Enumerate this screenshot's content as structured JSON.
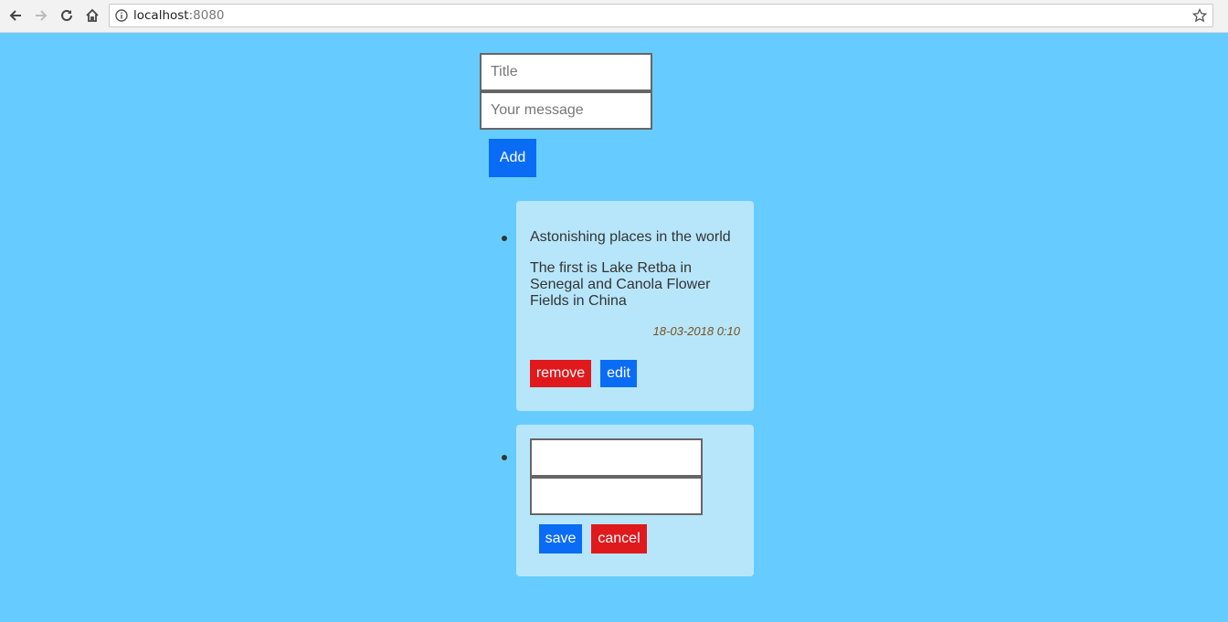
{
  "browser": {
    "url_host": "localhost",
    "url_port": ":8080",
    "icons": [
      "back-icon",
      "forward-icon",
      "reload-icon",
      "home-icon",
      "info-icon",
      "star-icon"
    ]
  },
  "form": {
    "title_placeholder": "Title",
    "message_placeholder": "Your message",
    "add_label": "Add"
  },
  "notes": [
    {
      "title": "Astonishing places in the world",
      "body": "The first is Lake Retba in Senegal and Canola Flower Fields in China",
      "date": "18-03-2018 0:10",
      "remove_label": "remove",
      "edit_label": "edit"
    }
  ],
  "edit_note": {
    "title_value": "",
    "body_value": "",
    "save_label": "save",
    "cancel_label": "cancel"
  },
  "colors": {
    "background": "#66ccff",
    "card": "#b7e6fb",
    "primary": "#0a6cf5",
    "danger": "#e0191d"
  }
}
